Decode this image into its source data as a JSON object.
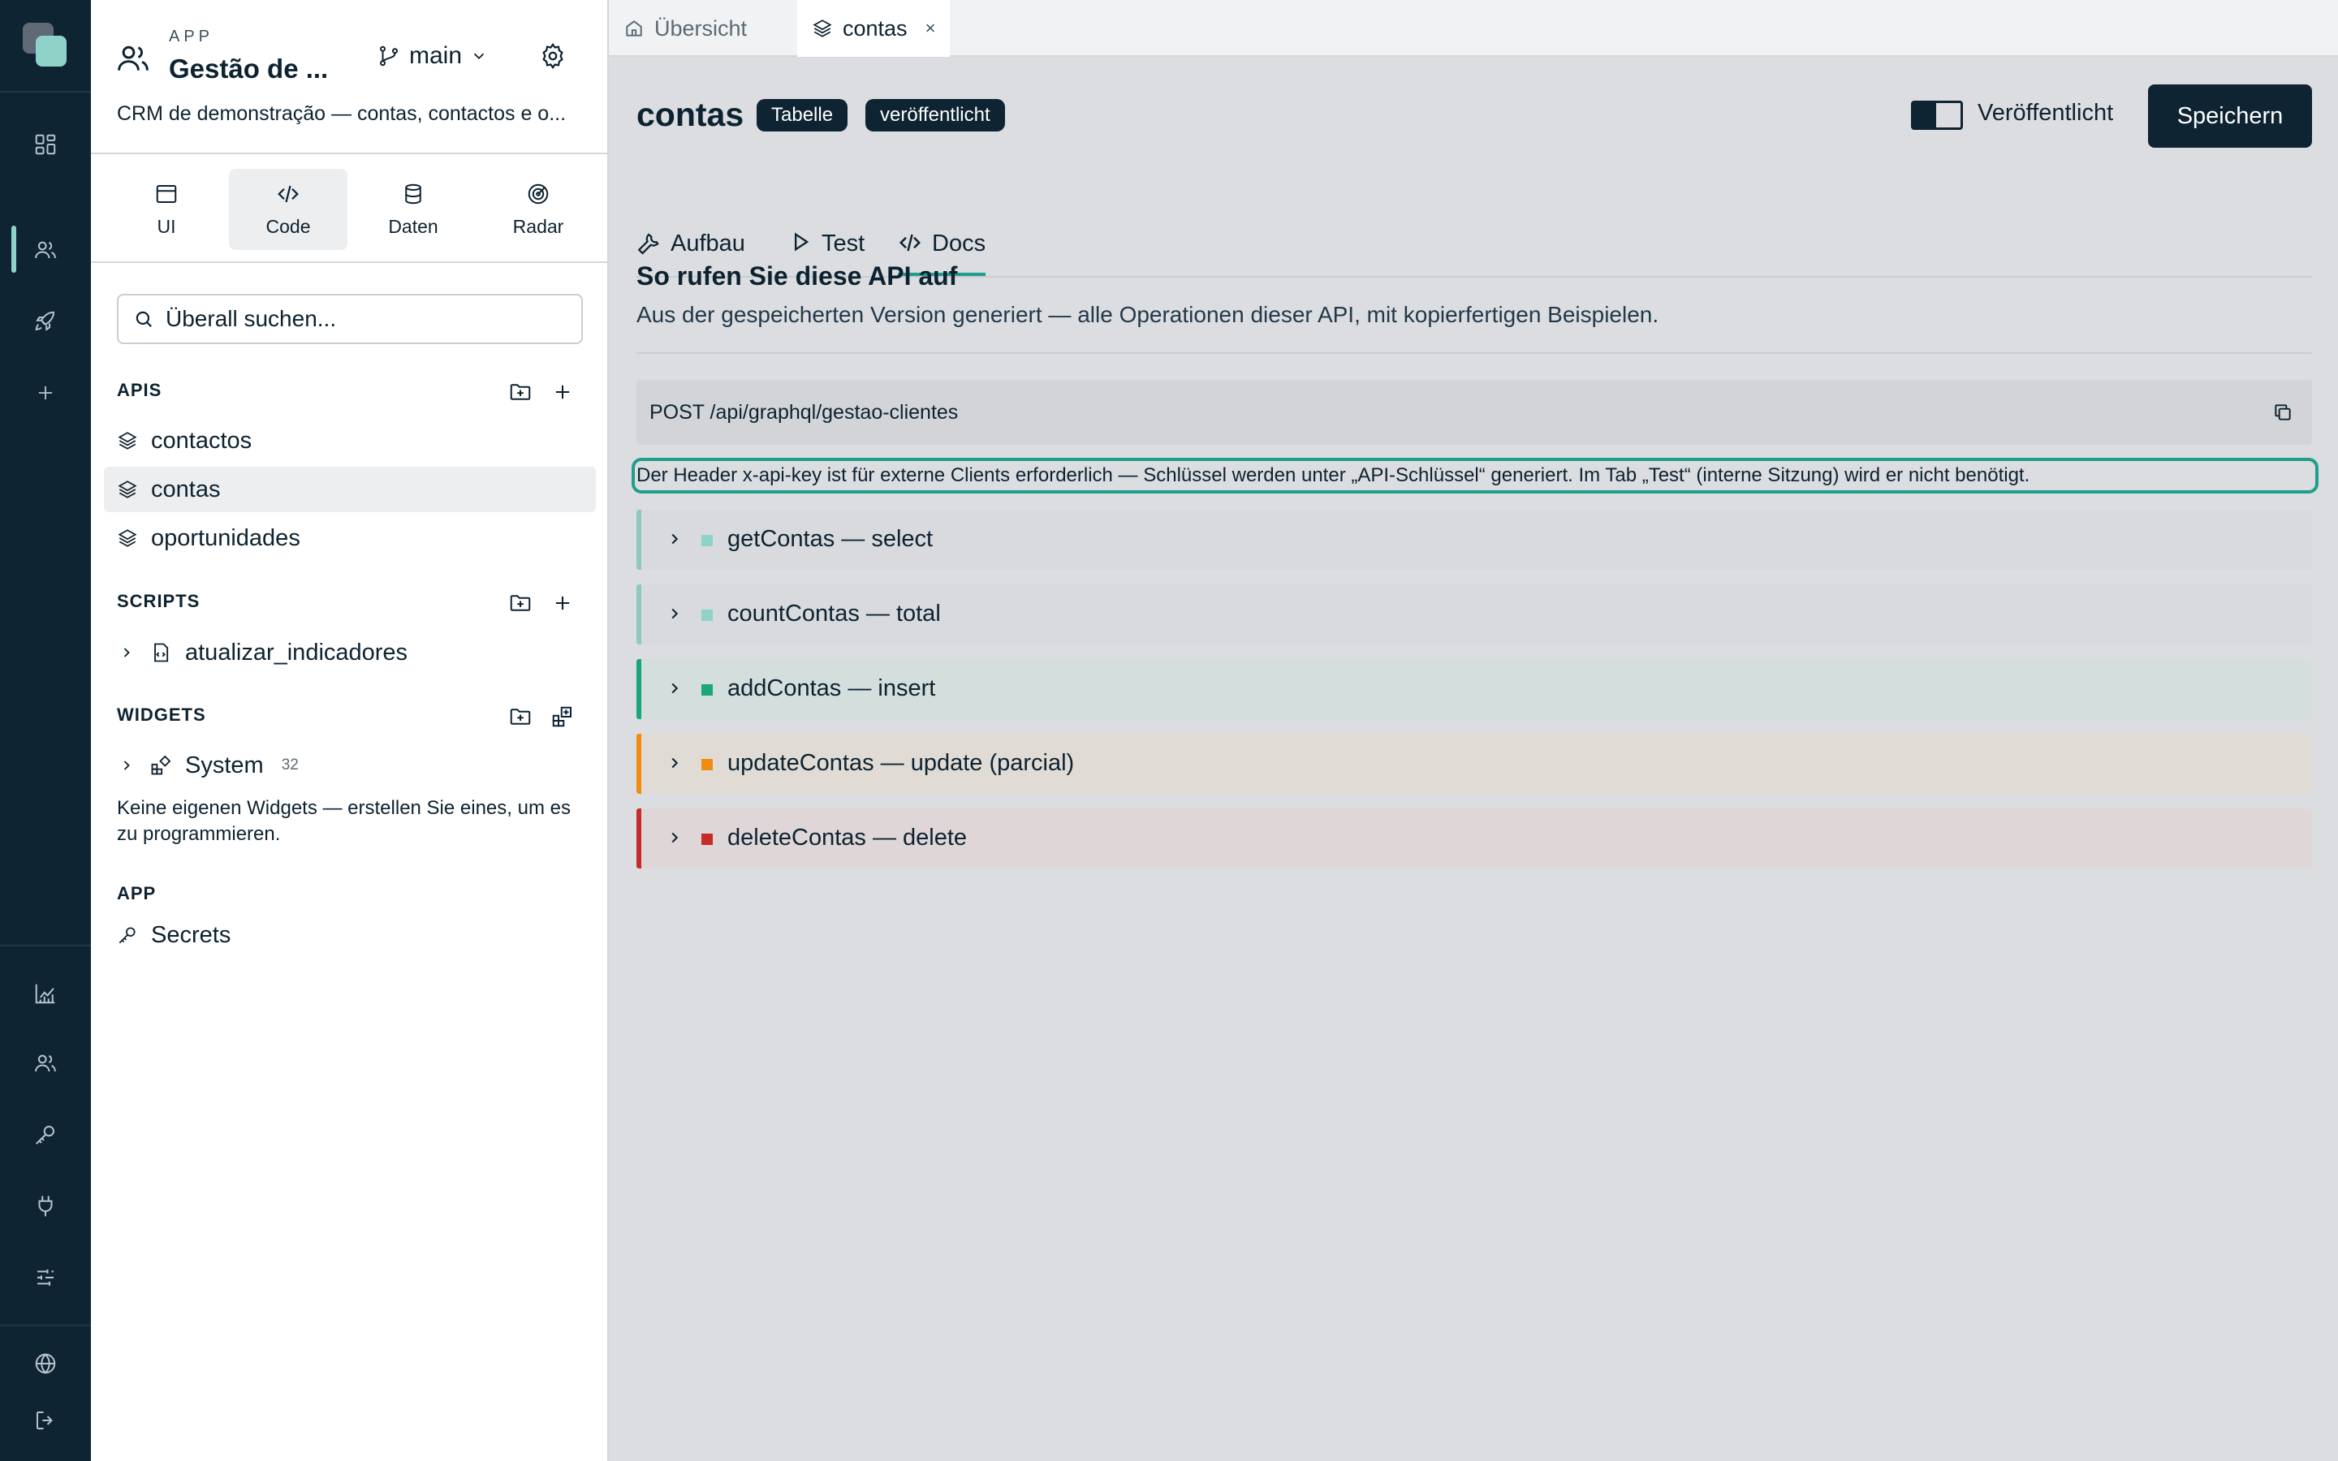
{
  "colors": {
    "rail_bg": "#0e2433",
    "accent": "#1f9e8e",
    "select": "#8fd3c8",
    "insert": "#1aa67a",
    "update": "#f08c12",
    "delete": "#c62a2a"
  },
  "rail": {
    "icons": [
      "dashboard-icon",
      "users-icon",
      "rocket-icon",
      "plus-icon",
      "chart-icon",
      "team-icon",
      "key-icon",
      "plug-icon",
      "sliders-icon",
      "globe-icon",
      "logout-icon"
    ]
  },
  "app": {
    "kicker": "APP",
    "title": "Gestão de ...",
    "branch": "main",
    "description": "CRM de demonstração — contas, contactos e o..."
  },
  "modes": [
    {
      "label": "UI",
      "icon": "window-icon"
    },
    {
      "label": "Code",
      "icon": "code-icon"
    },
    {
      "label": "Daten",
      "icon": "database-icon"
    },
    {
      "label": "Radar",
      "icon": "radar-icon"
    }
  ],
  "search": {
    "placeholder": "Überall suchen..."
  },
  "sections": {
    "apis": {
      "label": "APIS",
      "items": [
        {
          "label": "contactos"
        },
        {
          "label": "contas"
        },
        {
          "label": "oportunidades"
        }
      ]
    },
    "scripts": {
      "label": "SCRIPTS",
      "items": [
        {
          "label": "atualizar_indicadores"
        }
      ]
    },
    "widgets": {
      "label": "WIDGETS",
      "items": [
        {
          "label": "System",
          "count": "32"
        }
      ],
      "note": "Keine eigenen Widgets — erstellen Sie eines, um es zu programmieren."
    },
    "app": {
      "label": "APP",
      "items": [
        {
          "label": "Secrets"
        }
      ]
    }
  },
  "tabs": [
    {
      "label": "Übersicht"
    },
    {
      "label": "contas",
      "close": "×"
    }
  ],
  "main": {
    "title": "contas",
    "badges": [
      "Tabelle",
      "veröffentlicht"
    ],
    "published_label": "Veröffentlicht",
    "published": true,
    "save_label": "Speichern",
    "subtabs": [
      {
        "label": "Aufbau"
      },
      {
        "label": "Test"
      },
      {
        "label": "Docs"
      }
    ],
    "section_title": "So rufen Sie diese API auf",
    "section_subtitle": "Aus der gespeicherten Version generiert — alle Operationen dieser API, mit kopierfertigen Beispielen.",
    "endpoint": "POST /api/graphql/gestao-clientes",
    "hint": "Der Header x-api-key ist für externe Clients erforderlich — Schlüssel werden unter „API-Schlüssel“ generiert. Im Tab „Test“ (interne Sitzung) wird er nicht benötigt.",
    "operations": [
      {
        "label": "getContas — select",
        "kind": "select"
      },
      {
        "label": "countContas — total",
        "kind": "select"
      },
      {
        "label": "addContas — insert",
        "kind": "insert"
      },
      {
        "label": "updateContas — update (parcial)",
        "kind": "update"
      },
      {
        "label": "deleteContas — delete",
        "kind": "delete"
      }
    ]
  }
}
